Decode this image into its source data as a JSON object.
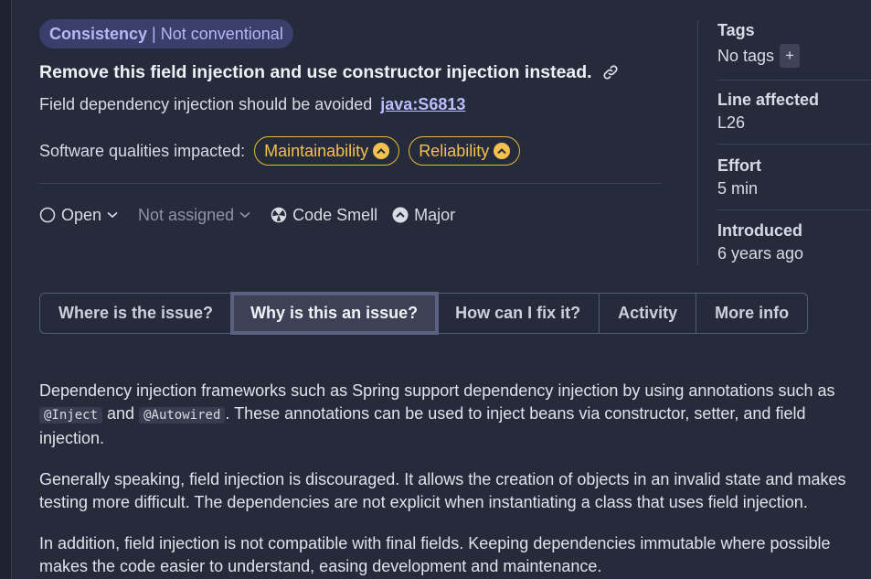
{
  "badge": {
    "category": "Consistency",
    "attribute": "Not conventional"
  },
  "issue": {
    "title": "Remove this field injection and use constructor injection instead.",
    "rule_text": "Field dependency injection should be avoided",
    "rule_key": "java:S6813"
  },
  "qualities": {
    "label": "Software qualities impacted:",
    "items": [
      "Maintainability",
      "Reliability"
    ]
  },
  "meta": {
    "status": "Open",
    "assignee": "Not assigned",
    "type": "Code Smell",
    "severity": "Major"
  },
  "sidebar": {
    "tags_label": "Tags",
    "tags_value": "No tags",
    "tags_add": "+",
    "line_label": "Line affected",
    "line_value": "L26",
    "effort_label": "Effort",
    "effort_value": "5 min",
    "introduced_label": "Introduced",
    "introduced_value": "6 years ago"
  },
  "tabs": [
    "Where is the issue?",
    "Why is this an issue?",
    "How can I fix it?",
    "Activity",
    "More info"
  ],
  "content": {
    "p1_a": "Dependency injection frameworks such as Spring support dependency injection by using annotations such as",
    "p1_code1": "@Inject",
    "p1_and": "and",
    "p1_code2": "@Autowired",
    "p1_b": ". These annotations can be used to inject beans via constructor, setter, and field injection.",
    "p2": "Generally speaking, field injection is discouraged. It allows the creation of objects in an invalid state and makes testing more difficult. The dependencies are not explicit when instantiating a class that uses field injection.",
    "p3": "In addition, field injection is not compatible with final fields. Keeping dependencies immutable where possible makes the code easier to understand, easing development and maintenance."
  },
  "colors": {
    "background": "#262b3b",
    "accent": "#b8beff",
    "quality": "#f2c14e"
  }
}
